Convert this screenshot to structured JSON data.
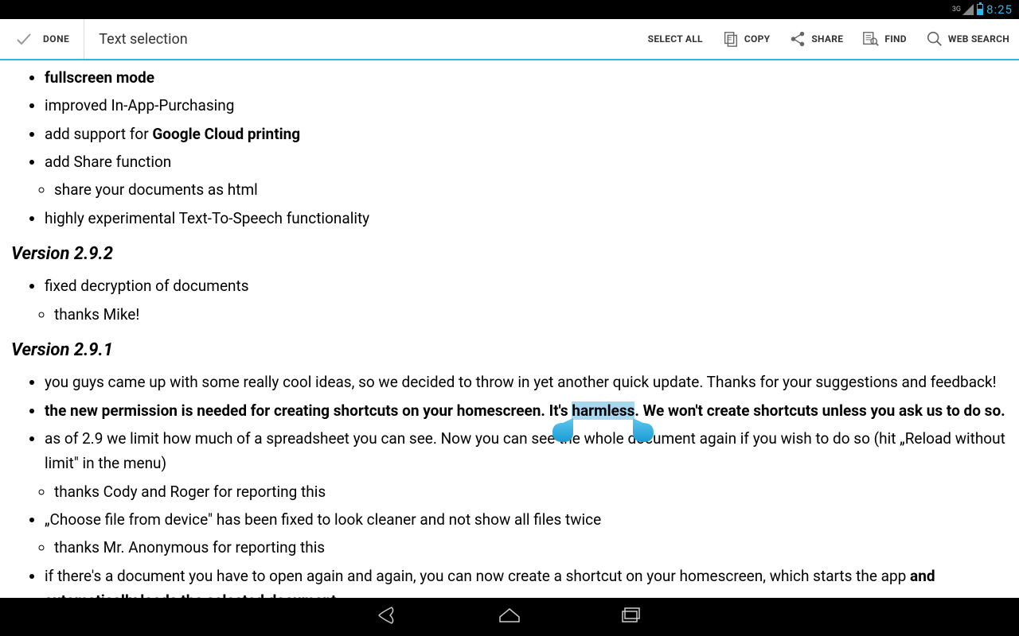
{
  "status": {
    "network": "3G",
    "time": "8:25"
  },
  "actionBar": {
    "doneLabel": "DONE",
    "title": "Text selection",
    "selectAll": "SELECT ALL",
    "copy": "COPY",
    "share": "SHARE",
    "find": "FIND",
    "webSearch": "WEB SEARCH"
  },
  "doc": {
    "topItems": {
      "fullscreen": "fullscreen mode",
      "iap": "improved In-App-Purchasing",
      "cloudPre": "add support for ",
      "cloudBold": "Google Cloud printing",
      "share": "add Share function",
      "shareSub": "share your documents as html",
      "tts": "highly experimental Text-To-Speech functionality"
    },
    "v292": {
      "heading": "Version 2.9.2",
      "item1": "fixed decryption of documents",
      "sub1": "thanks Mike!"
    },
    "v291": {
      "heading": "Version 2.9.1",
      "item1": "you guys came up with some really cool ideas, so we decided to throw in yet another quick update. Thanks for your suggestions and feedback!",
      "perm1": "the new permission is needed for creating shortcuts on your homescreen. It's ",
      "permSel": "harmless",
      "perm2": ". We won't create shortcuts unless you ask us to do so.",
      "item3": "as of 2.9 we limit how much of a spreadsheet you can see. Now you can see the whole document again if you wish to do so (hit „Reload without limit\" in the menu)",
      "sub3": "thanks Cody and Roger for reporting this",
      "item4": "„Choose file from device\" has been fixed to look cleaner and not show all files twice",
      "sub4": "thanks Mr. Anonymous for reporting this",
      "item5a": "if there's a document you have to open again and again, you can now create a shortcut on your homescreen, which starts the app ",
      "item5b": "and automatically loads the selected document"
    }
  }
}
